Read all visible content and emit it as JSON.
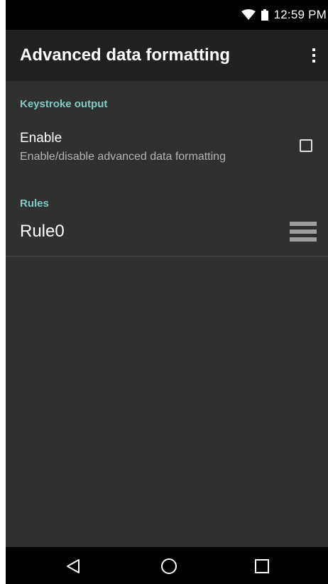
{
  "status_bar": {
    "time": "12:59 PM",
    "icons": [
      "wifi-icon",
      "battery-icon"
    ]
  },
  "app_bar": {
    "title": "Advanced data formatting",
    "overflow_icon": "more-vert-icon"
  },
  "sections": {
    "keystroke": {
      "header": "Keystroke output",
      "enable": {
        "title": "Enable",
        "summary": "Enable/disable advanced data formatting",
        "checked": false
      }
    },
    "rules": {
      "header": "Rules",
      "items": [
        {
          "label": "Rule0",
          "handle_icon": "drag-handle-icon"
        }
      ]
    }
  },
  "nav_bar": {
    "icons": [
      "back-icon",
      "home-icon",
      "recents-icon"
    ]
  },
  "colors": {
    "background": "#303030",
    "app_bar": "#212121",
    "status_bar": "#000000",
    "accent": "#80cbc4",
    "secondary_text": "#b3b3b3"
  }
}
